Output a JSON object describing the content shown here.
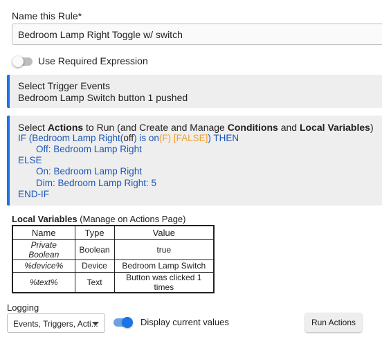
{
  "name_rule": {
    "label": "Name this Rule*",
    "value": "Bedroom Lamp Right Toggle w/ switch"
  },
  "required_expression": {
    "label": "Use Required Expression",
    "enabled": false
  },
  "trigger": {
    "title": "Select Trigger Events",
    "event": "Bedroom Lamp Switch button 1 pushed"
  },
  "actions": {
    "title_pre": "Select ",
    "title_b1": "Actions",
    "title_mid1": " to Run (and Create and Manage ",
    "title_b2": "Conditions",
    "title_mid2": " and ",
    "title_b3": "Local Variables",
    "title_post": ")",
    "if_pre": "IF (Bedroom Lamp Right(",
    "if_off": "off",
    "if_mid": ") is on",
    "if_f": "(F)",
    "if_false": " [FALSE]",
    "if_post": ") THEN",
    "off_line": "Off: Bedroom Lamp Right",
    "else": "ELSE",
    "on_line": "On: Bedroom Lamp Right",
    "dim_line": "Dim: Bedroom Lamp Right: 5",
    "endif": "END-IF"
  },
  "local_vars": {
    "title": "Local Variables",
    "subtitle": " (Manage on Actions Page)",
    "headers": [
      "Name",
      "Type",
      "Value"
    ],
    "rows": [
      [
        "Private Boolean",
        "Boolean",
        "true"
      ],
      [
        "%device%",
        "Device",
        "Bedroom Lamp Switch"
      ],
      [
        "%text%",
        "Text",
        "Button was clicked 1 times"
      ]
    ]
  },
  "logging": {
    "label": "Logging",
    "selected": "Events, Triggers, Acti...",
    "display_label": "Display current values",
    "display_enabled": true
  },
  "run_button": "Run Actions",
  "colors": {
    "accent": "#1a73e8",
    "link_blue": "#1a56b8",
    "orange": "#f4a02a",
    "panel_bg": "#eeeeee"
  }
}
